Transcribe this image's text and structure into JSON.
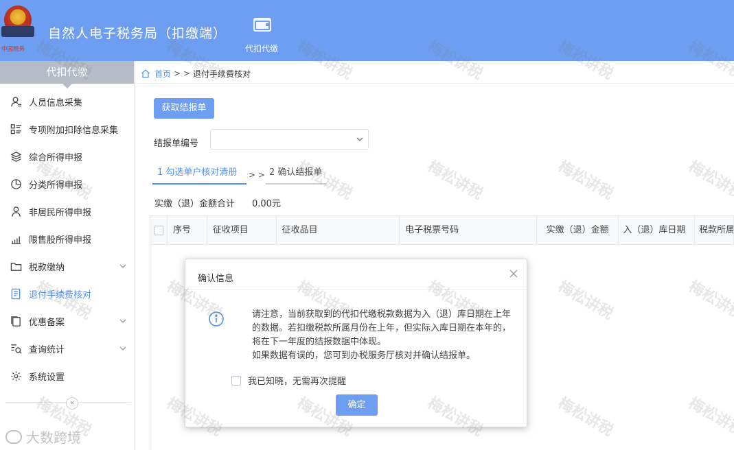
{
  "header": {
    "logo_text": "中国税务",
    "app_title": "自然人电子税务局（扣缴端）",
    "module_label": "代扣代缴"
  },
  "sidebar": {
    "title": "代扣代缴",
    "items": [
      {
        "label": "人员信息采集",
        "icon": "person-icon"
      },
      {
        "label": "专项附加扣除信息采集",
        "icon": "list-grid-icon"
      },
      {
        "label": "综合所得申报",
        "icon": "layers-icon"
      },
      {
        "label": "分类所得申报",
        "icon": "pie-chart-icon"
      },
      {
        "label": "非居民所得申报",
        "icon": "user-outline-icon"
      },
      {
        "label": "限售股所得申报",
        "icon": "bar-chart-icon"
      },
      {
        "label": "税款缴纳",
        "icon": "folder-icon",
        "expandable": true
      },
      {
        "label": "退付手续费核对",
        "icon": "document-icon",
        "active": true
      },
      {
        "label": "优惠备案",
        "icon": "copy-icon",
        "expandable": true
      },
      {
        "label": "查询统计",
        "icon": "search-list-icon",
        "expandable": true
      },
      {
        "label": "系统设置",
        "icon": "gear-icon"
      }
    ],
    "collapse_symbol": "«"
  },
  "breadcrumb": {
    "home": "首页",
    "separator": "> >",
    "current": "退付手续费核对"
  },
  "main": {
    "fetch_button": "获取结报单",
    "field_label": "结报单编号",
    "select_value": "",
    "steps": [
      "1 勾选单户核对清册",
      "2 确认结报单"
    ],
    "step_separator": "> >",
    "sum_label": "实缴（退）金额合计",
    "sum_value": "0.00元",
    "table_columns": [
      "序号",
      "征收项目",
      "征收品目",
      "电子税票号码",
      "实缴（退）金额",
      "入（退）库日期",
      "税款所属"
    ]
  },
  "dialog": {
    "title": "确认信息",
    "message_lines": [
      "请注意，当前获取到的代扣代缴税款数据为入（退）库日期在上年的数据。若扣缴税款所属月份在上年，但实际入库日期在本年的，将在下一年度的结报数据中体现。",
      "如果数据有误的，您可到办税服务厅核对并确认结报单。"
    ],
    "checkbox_label": "我已知晓，无需再次提醒",
    "ok_button": "确定"
  },
  "watermark": {
    "text": "梅松讲税",
    "brand": "大数跨境"
  },
  "colors": {
    "header": "#6d9ef2",
    "accent": "#4f8ff0",
    "sidebar_head": "#b6bcc6"
  }
}
